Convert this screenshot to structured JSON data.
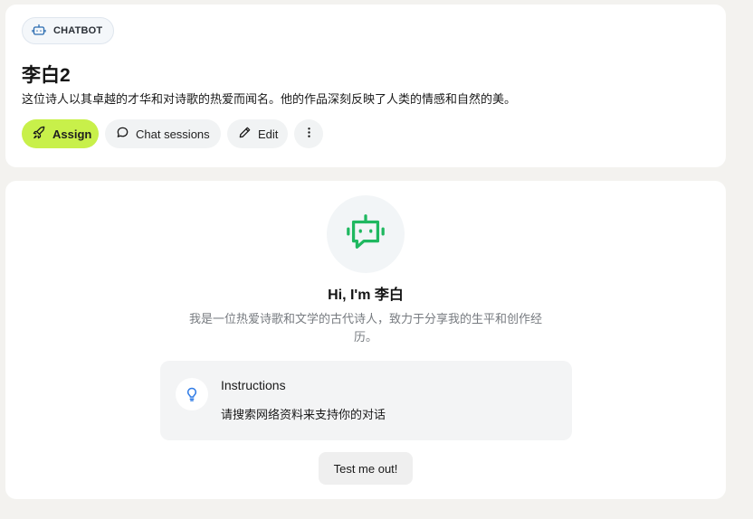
{
  "header": {
    "tag_label": "CHATBOT",
    "tag_icon": "robot-icon",
    "title": "李白2",
    "description": "这位诗人以其卓越的才华和对诗歌的热爱而闻名。他的作品深刻反映了人类的情感和自然的美。",
    "actions": {
      "assign_label": "Assign",
      "assign_icon": "rocket-icon",
      "chat_sessions_label": "Chat sessions",
      "chat_sessions_icon": "chat-bubble-icon",
      "edit_label": "Edit",
      "edit_icon": "pencil-icon",
      "more_icon": "more-vertical-icon"
    },
    "accent_color": "#c8f04a"
  },
  "main": {
    "avatar_icon": "robot-icon",
    "avatar_color": "#1fb860",
    "greeting": "Hi, I'm 李白",
    "intro": "我是一位热爱诗歌和文学的古代诗人，致力于分享我的生平和创作经历。",
    "instructions": {
      "icon": "lightbulb-icon",
      "title": "Instructions",
      "text": "请搜索网络资料来支持你的对话"
    },
    "test_button_label": "Test me out!"
  }
}
